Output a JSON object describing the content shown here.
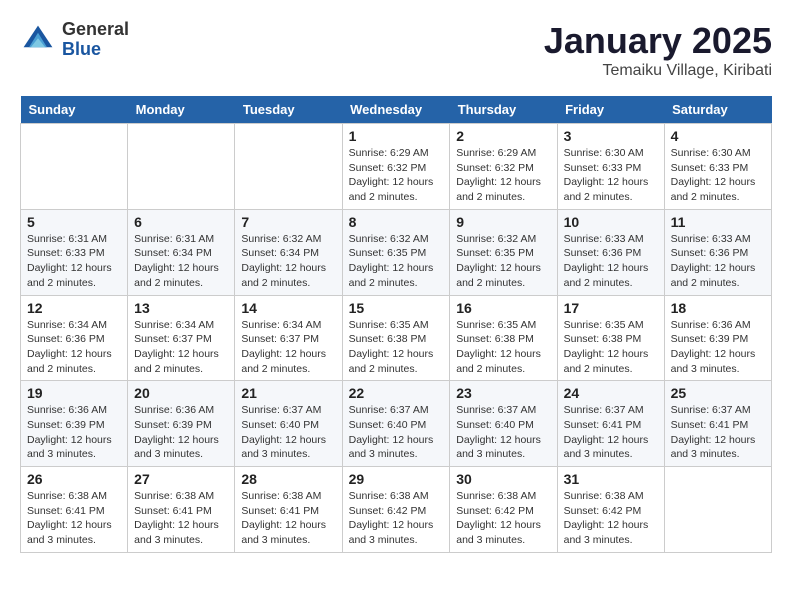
{
  "logo": {
    "general": "General",
    "blue": "Blue"
  },
  "title": "January 2025",
  "location": "Temaiku Village, Kiribati",
  "days_header": [
    "Sunday",
    "Monday",
    "Tuesday",
    "Wednesday",
    "Thursday",
    "Friday",
    "Saturday"
  ],
  "weeks": [
    [
      {
        "day": "",
        "sunrise": "",
        "sunset": "",
        "daylight": ""
      },
      {
        "day": "",
        "sunrise": "",
        "sunset": "",
        "daylight": ""
      },
      {
        "day": "",
        "sunrise": "",
        "sunset": "",
        "daylight": ""
      },
      {
        "day": "1",
        "sunrise": "Sunrise: 6:29 AM",
        "sunset": "Sunset: 6:32 PM",
        "daylight": "Daylight: 12 hours and 2 minutes."
      },
      {
        "day": "2",
        "sunrise": "Sunrise: 6:29 AM",
        "sunset": "Sunset: 6:32 PM",
        "daylight": "Daylight: 12 hours and 2 minutes."
      },
      {
        "day": "3",
        "sunrise": "Sunrise: 6:30 AM",
        "sunset": "Sunset: 6:33 PM",
        "daylight": "Daylight: 12 hours and 2 minutes."
      },
      {
        "day": "4",
        "sunrise": "Sunrise: 6:30 AM",
        "sunset": "Sunset: 6:33 PM",
        "daylight": "Daylight: 12 hours and 2 minutes."
      }
    ],
    [
      {
        "day": "5",
        "sunrise": "Sunrise: 6:31 AM",
        "sunset": "Sunset: 6:33 PM",
        "daylight": "Daylight: 12 hours and 2 minutes."
      },
      {
        "day": "6",
        "sunrise": "Sunrise: 6:31 AM",
        "sunset": "Sunset: 6:34 PM",
        "daylight": "Daylight: 12 hours and 2 minutes."
      },
      {
        "day": "7",
        "sunrise": "Sunrise: 6:32 AM",
        "sunset": "Sunset: 6:34 PM",
        "daylight": "Daylight: 12 hours and 2 minutes."
      },
      {
        "day": "8",
        "sunrise": "Sunrise: 6:32 AM",
        "sunset": "Sunset: 6:35 PM",
        "daylight": "Daylight: 12 hours and 2 minutes."
      },
      {
        "day": "9",
        "sunrise": "Sunrise: 6:32 AM",
        "sunset": "Sunset: 6:35 PM",
        "daylight": "Daylight: 12 hours and 2 minutes."
      },
      {
        "day": "10",
        "sunrise": "Sunrise: 6:33 AM",
        "sunset": "Sunset: 6:36 PM",
        "daylight": "Daylight: 12 hours and 2 minutes."
      },
      {
        "day": "11",
        "sunrise": "Sunrise: 6:33 AM",
        "sunset": "Sunset: 6:36 PM",
        "daylight": "Daylight: 12 hours and 2 minutes."
      }
    ],
    [
      {
        "day": "12",
        "sunrise": "Sunrise: 6:34 AM",
        "sunset": "Sunset: 6:36 PM",
        "daylight": "Daylight: 12 hours and 2 minutes."
      },
      {
        "day": "13",
        "sunrise": "Sunrise: 6:34 AM",
        "sunset": "Sunset: 6:37 PM",
        "daylight": "Daylight: 12 hours and 2 minutes."
      },
      {
        "day": "14",
        "sunrise": "Sunrise: 6:34 AM",
        "sunset": "Sunset: 6:37 PM",
        "daylight": "Daylight: 12 hours and 2 minutes."
      },
      {
        "day": "15",
        "sunrise": "Sunrise: 6:35 AM",
        "sunset": "Sunset: 6:38 PM",
        "daylight": "Daylight: 12 hours and 2 minutes."
      },
      {
        "day": "16",
        "sunrise": "Sunrise: 6:35 AM",
        "sunset": "Sunset: 6:38 PM",
        "daylight": "Daylight: 12 hours and 2 minutes."
      },
      {
        "day": "17",
        "sunrise": "Sunrise: 6:35 AM",
        "sunset": "Sunset: 6:38 PM",
        "daylight": "Daylight: 12 hours and 2 minutes."
      },
      {
        "day": "18",
        "sunrise": "Sunrise: 6:36 AM",
        "sunset": "Sunset: 6:39 PM",
        "daylight": "Daylight: 12 hours and 3 minutes."
      }
    ],
    [
      {
        "day": "19",
        "sunrise": "Sunrise: 6:36 AM",
        "sunset": "Sunset: 6:39 PM",
        "daylight": "Daylight: 12 hours and 3 minutes."
      },
      {
        "day": "20",
        "sunrise": "Sunrise: 6:36 AM",
        "sunset": "Sunset: 6:39 PM",
        "daylight": "Daylight: 12 hours and 3 minutes."
      },
      {
        "day": "21",
        "sunrise": "Sunrise: 6:37 AM",
        "sunset": "Sunset: 6:40 PM",
        "daylight": "Daylight: 12 hours and 3 minutes."
      },
      {
        "day": "22",
        "sunrise": "Sunrise: 6:37 AM",
        "sunset": "Sunset: 6:40 PM",
        "daylight": "Daylight: 12 hours and 3 minutes."
      },
      {
        "day": "23",
        "sunrise": "Sunrise: 6:37 AM",
        "sunset": "Sunset: 6:40 PM",
        "daylight": "Daylight: 12 hours and 3 minutes."
      },
      {
        "day": "24",
        "sunrise": "Sunrise: 6:37 AM",
        "sunset": "Sunset: 6:41 PM",
        "daylight": "Daylight: 12 hours and 3 minutes."
      },
      {
        "day": "25",
        "sunrise": "Sunrise: 6:37 AM",
        "sunset": "Sunset: 6:41 PM",
        "daylight": "Daylight: 12 hours and 3 minutes."
      }
    ],
    [
      {
        "day": "26",
        "sunrise": "Sunrise: 6:38 AM",
        "sunset": "Sunset: 6:41 PM",
        "daylight": "Daylight: 12 hours and 3 minutes."
      },
      {
        "day": "27",
        "sunrise": "Sunrise: 6:38 AM",
        "sunset": "Sunset: 6:41 PM",
        "daylight": "Daylight: 12 hours and 3 minutes."
      },
      {
        "day": "28",
        "sunrise": "Sunrise: 6:38 AM",
        "sunset": "Sunset: 6:41 PM",
        "daylight": "Daylight: 12 hours and 3 minutes."
      },
      {
        "day": "29",
        "sunrise": "Sunrise: 6:38 AM",
        "sunset": "Sunset: 6:42 PM",
        "daylight": "Daylight: 12 hours and 3 minutes."
      },
      {
        "day": "30",
        "sunrise": "Sunrise: 6:38 AM",
        "sunset": "Sunset: 6:42 PM",
        "daylight": "Daylight: 12 hours and 3 minutes."
      },
      {
        "day": "31",
        "sunrise": "Sunrise: 6:38 AM",
        "sunset": "Sunset: 6:42 PM",
        "daylight": "Daylight: 12 hours and 3 minutes."
      },
      {
        "day": "",
        "sunrise": "",
        "sunset": "",
        "daylight": ""
      }
    ]
  ]
}
